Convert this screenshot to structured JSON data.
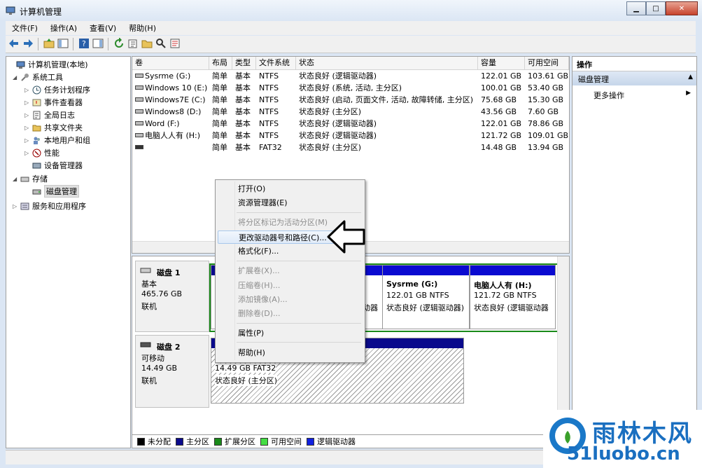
{
  "title": "计算机管理",
  "menu": [
    "文件(F)",
    "操作(A)",
    "查看(V)",
    "帮助(H)"
  ],
  "tree": {
    "root": "计算机管理(本地)",
    "system_tools": "系统工具",
    "task_scheduler": "任务计划程序",
    "event_viewer": "事件查看器",
    "shared_folders": "共享文件夹",
    "local_users": "本地用户和组",
    "performance": "性能",
    "device_manager": "设备管理器",
    "global_log": "全局日志",
    "storage": "存储",
    "disk_management": "磁盘管理",
    "services": "服务和应用程序"
  },
  "list": {
    "headers": [
      "卷",
      "布局",
      "类型",
      "文件系统",
      "状态",
      "容量",
      "可用空间"
    ],
    "rows": [
      [
        "Sysrme (G:)",
        "简单",
        "基本",
        "NTFS",
        "状态良好 (逻辑驱动器)",
        "122.01 GB",
        "103.61 GB"
      ],
      [
        "Windows 10 (E:)",
        "简单",
        "基本",
        "NTFS",
        "状态良好 (系统, 活动, 主分区)",
        "100.01 GB",
        "53.40 GB"
      ],
      [
        "Windows7E (C:)",
        "简单",
        "基本",
        "NTFS",
        "状态良好 (启动, 页面文件, 活动, 故障转储, 主分区)",
        "75.68 GB",
        "15.30 GB"
      ],
      [
        "Windows8 (D:)",
        "简单",
        "基本",
        "NTFS",
        "状态良好 (主分区)",
        "43.56 GB",
        "7.60 GB"
      ],
      [
        "Word (F:)",
        "简单",
        "基本",
        "NTFS",
        "状态良好 (逻辑驱动器)",
        "122.01 GB",
        "78.86 GB"
      ],
      [
        "电脑人人有 (H:)",
        "简单",
        "基本",
        "NTFS",
        "状态良好 (逻辑驱动器)",
        "121.72 GB",
        "109.01 GB"
      ],
      [
        "",
        "简单",
        "基本",
        "FAT32",
        "状态良好 (主分区)",
        "14.48 GB",
        "13.94 GB"
      ]
    ]
  },
  "disks": {
    "disk1": {
      "name": "磁盘 1",
      "type": "基本",
      "size": "465.76 GB",
      "status": "联机"
    },
    "disk2": {
      "name": "磁盘 2",
      "type": "可移动",
      "size": "14.49 GB",
      "status": "联机"
    },
    "disk1_partial_1": "动器",
    "disk1_partial_2": "动器",
    "sysrme": {
      "name": "Sysrme  (G:)",
      "size": "122.01 GB NTFS",
      "status": "状态良好 (逻辑驱动器)"
    },
    "renren": {
      "name": "电脑人人有  (H:)",
      "size": "121.72 GB NTFS",
      "status": "状态良好 (逻辑驱动器"
    },
    "usb": {
      "size": "14.49 GB FAT32",
      "status": "状态良好 (主分区)"
    }
  },
  "legend": [
    {
      "label": "未分配",
      "color": "#000000"
    },
    {
      "label": "主分区",
      "color": "#0a0a8c"
    },
    {
      "label": "扩展分区",
      "color": "#1a8a1a"
    },
    {
      "label": "可用空间",
      "color": "#44dd44"
    },
    {
      "label": "逻辑驱动器",
      "color": "#1020e0"
    }
  ],
  "actions": {
    "header": "操作",
    "section": "磁盘管理",
    "more": "更多操作"
  },
  "context_menu": {
    "open": "打开(O)",
    "explore": "资源管理器(E)",
    "mark_active": "将分区标记为活动分区(M)",
    "change_letter": "更改驱动器号和路径(C)...",
    "format": "格式化(F)...",
    "extend": "扩展卷(X)...",
    "shrink": "压缩卷(H)...",
    "mirror": "添加镜像(A)...",
    "delete": "删除卷(D)...",
    "properties": "属性(P)",
    "help": "帮助(H)"
  },
  "watermark": {
    "brand": "雨林木风",
    "url": "51luobo.cn"
  }
}
